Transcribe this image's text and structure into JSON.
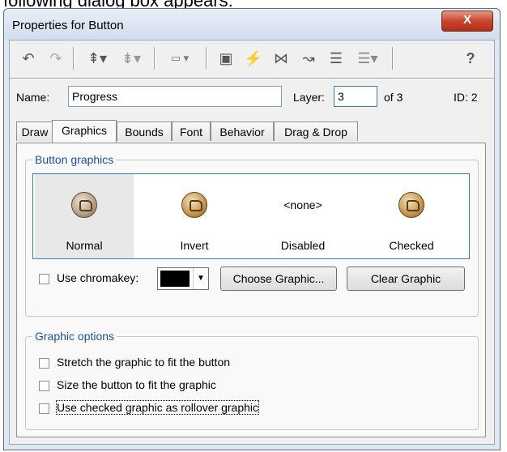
{
  "caption_above": "following dialog box appears:",
  "window": {
    "title": "Properties for Button",
    "close_label": "X"
  },
  "toolbar": {
    "icons": [
      "undo-icon",
      "redo-icon",
      "bring-forward-icon",
      "send-backward-icon",
      "align-icon",
      "properties-icon",
      "actions-icon",
      "connect-icon",
      "path-icon",
      "list-icon",
      "list-dropdown-icon",
      "help-icon"
    ],
    "help_label": "?"
  },
  "name_row": {
    "name_label": "Name:",
    "name_value": "Progress",
    "layer_label": "Layer:",
    "layer_value": "3",
    "of_text": "of 3",
    "id_text": "ID: 2"
  },
  "tabs": [
    "Draw",
    "Graphics",
    "Bounds",
    "Font",
    "Behavior",
    "Drag & Drop"
  ],
  "active_tab": "Graphics",
  "button_graphics": {
    "legend": "Button graphics",
    "slots": [
      {
        "label": "Normal",
        "has_graphic": true,
        "selected": true
      },
      {
        "label": "Invert",
        "has_graphic": true,
        "selected": false
      },
      {
        "label": "Disabled",
        "has_graphic": false,
        "none_text": "<none>",
        "selected": false
      },
      {
        "label": "Checked",
        "has_graphic": true,
        "selected": false
      }
    ],
    "chromakey_label": "Use chromakey:",
    "chromakey_checked": false,
    "chromakey_color": "#000000",
    "choose_button": "Choose Graphic...",
    "clear_button": "Clear Graphic"
  },
  "graphic_options": {
    "legend": "Graphic options",
    "options": [
      {
        "label": "Stretch the graphic to fit the button",
        "checked": false
      },
      {
        "label": "Size the button to fit the graphic",
        "checked": false
      },
      {
        "label": "Use checked graphic as rollover graphic",
        "checked": false
      }
    ]
  }
}
